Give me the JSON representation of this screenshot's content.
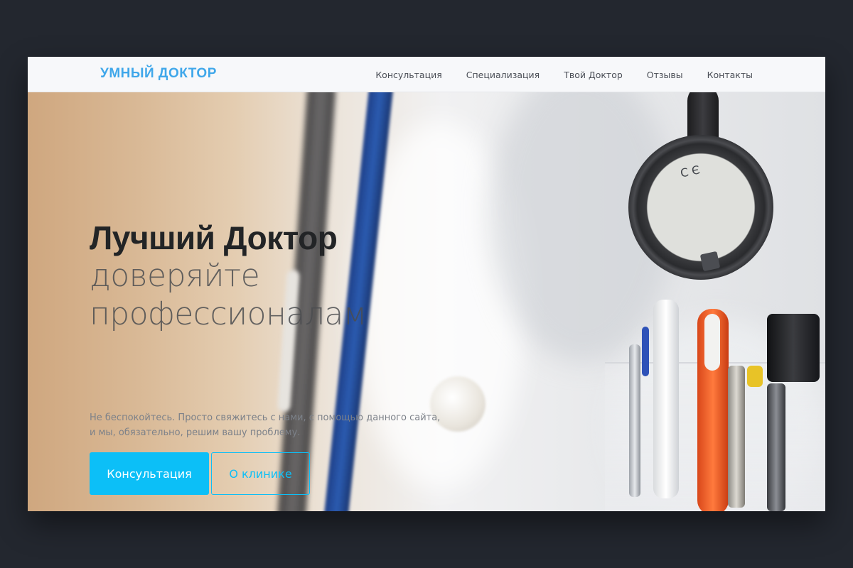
{
  "navbar": {
    "brand": "УМНЫЙ ДОКТОР",
    "links": [
      "Консультация",
      "Специализация",
      "Твой Доктор",
      "Отзывы",
      "Контакты"
    ]
  },
  "hero": {
    "title": "Лучший Доктор",
    "subtitle_line1": "доверяйте",
    "subtitle_line2": "профессионалам",
    "text_line1": "Не беспокойтесь. Просто свяжитесь с нами, с помощью данного сайта,",
    "text_line2": "и мы, обязательно, решим вашу проблему.",
    "primary_button": "Консультация",
    "secondary_button": "О клинике",
    "image_alt_text": "С Є"
  },
  "colors": {
    "page_background": "#23272f",
    "brand": "#3fa7ea",
    "accent": "#0cbff7",
    "navbar_background": "#f7f8fa"
  }
}
